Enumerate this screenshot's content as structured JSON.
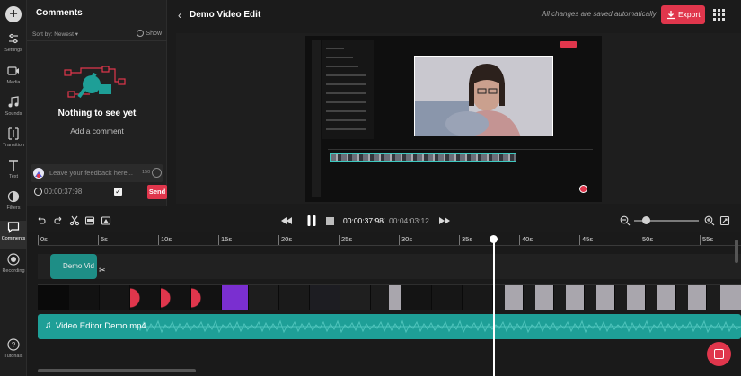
{
  "rail": {
    "items": [
      {
        "label": "Settings",
        "icon": "settings-icon"
      },
      {
        "label": "Media",
        "icon": "media-icon"
      },
      {
        "label": "Sounds",
        "icon": "sounds-icon"
      },
      {
        "label": "Transition",
        "icon": "transition-icon"
      },
      {
        "label": "Text",
        "icon": "text-icon"
      },
      {
        "label": "Filters",
        "icon": "filters-icon"
      },
      {
        "label": "Comments",
        "icon": "comments-icon",
        "active": true
      },
      {
        "label": "Recording",
        "icon": "recording-icon"
      },
      {
        "label": "Tutorials",
        "icon": "tutorials-icon"
      }
    ]
  },
  "comments": {
    "title": "Comments",
    "sort_label": "Sort by: Newest",
    "show_label": "Show",
    "empty_title": "Nothing to see yet",
    "empty_subtitle": "Add a comment",
    "input_placeholder": "Leave your feedback here...",
    "char_count": "150",
    "timestamp": "00:00:37:98",
    "send_label": "Send"
  },
  "header": {
    "project_title": "Demo Video Edit",
    "save_status": "All changes are saved automatically",
    "export_label": "Export"
  },
  "player": {
    "current_time": "00:00:37:98",
    "separator": "/",
    "duration": "00:04:03:12"
  },
  "timeline": {
    "ticks": [
      "0s",
      "5s",
      "10s",
      "15s",
      "20s",
      "25s",
      "30s",
      "35s",
      "40s",
      "45s",
      "50s",
      "55s"
    ],
    "comment_clip_label": "Demo Vid",
    "audio_clip_label": "Video Editor Demo.mp4"
  },
  "colors": {
    "accent": "#e0364c",
    "teal": "#1e9f97",
    "background": "#1b1b1b"
  }
}
